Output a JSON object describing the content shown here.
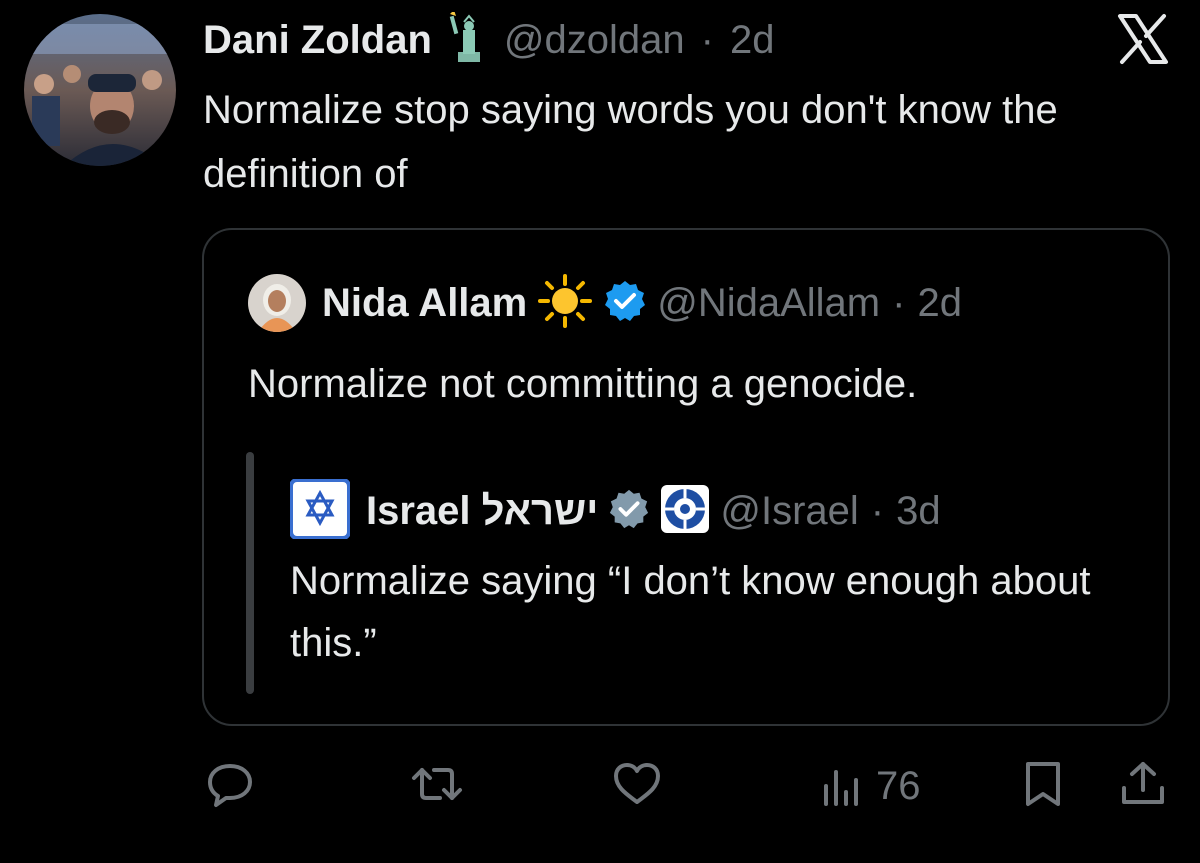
{
  "tweet": {
    "author_name": "Dani Zoldan",
    "handle": "@dzoldan",
    "separator": "·",
    "time": "2d",
    "text": "Normalize stop saying words you don't know the definition of",
    "avatar_icon": "profile-photo",
    "emoji_icon": "statue-of-liberty"
  },
  "quote": {
    "author_name": "Nida Allam",
    "handle": "@NidaAllam",
    "separator": "·",
    "time": "2d",
    "text": "Normalize not committing a genocide.",
    "emoji_icon": "sun",
    "verified_icon": "verified-badge",
    "verified_color": "#1d9bf0"
  },
  "nested_quote": {
    "author_name": "Israel ישראל",
    "handle": "@Israel",
    "separator": "·",
    "time": "3d",
    "text": "Normalize saying “I don’t know enough about this.”",
    "avatar_icon": "star-of-david-flag",
    "verified_icon": "government-verified-badge",
    "emblem_icon": "government-emblem"
  },
  "actions": {
    "views": "76",
    "icons": [
      "reply-icon",
      "retweet-icon",
      "like-icon",
      "views-icon",
      "bookmark-icon",
      "share-icon"
    ]
  },
  "colors": {
    "background": "#000000",
    "text": "#e7e9ea",
    "muted": "#71767b",
    "border": "#2f3336"
  }
}
